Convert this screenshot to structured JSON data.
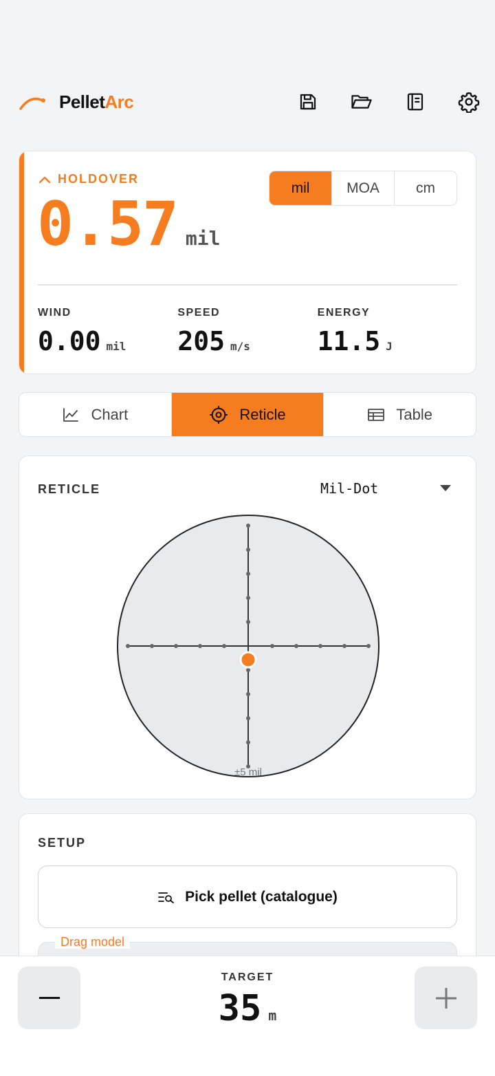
{
  "app": {
    "brand_part1": "Pellet",
    "brand_part2": "Arc",
    "accent": "#f57c1f"
  },
  "header": {
    "actions": [
      {
        "name": "save-icon"
      },
      {
        "name": "folder-open-icon"
      },
      {
        "name": "notebook-icon"
      },
      {
        "name": "gear-icon"
      }
    ]
  },
  "holdover": {
    "label": "HOLDOVER",
    "value": "0.57",
    "unit": "mil",
    "unit_options": [
      "mil",
      "MOA",
      "cm"
    ],
    "selected_unit": "mil"
  },
  "stats": {
    "wind": {
      "label": "WIND",
      "value": "0.00",
      "unit": "mil"
    },
    "speed": {
      "label": "SPEED",
      "value": "205",
      "unit": "m/s"
    },
    "energy": {
      "label": "ENERGY",
      "value": "11.5",
      "unit": "J"
    }
  },
  "view_tabs": [
    {
      "label": "Chart",
      "icon": "line-chart-icon"
    },
    {
      "label": "Reticle",
      "icon": "crosshair-icon",
      "active": true
    },
    {
      "label": "Table",
      "icon": "table-icon"
    }
  ],
  "reticle": {
    "title": "RETICLE",
    "selected_type": "Mil-Dot",
    "range_label": "±5 mil",
    "range_mil": 5,
    "impact_mil": {
      "x": 0,
      "y": 0.57
    }
  },
  "setup": {
    "title": "SETUP",
    "pick_pellet_label": "Pick pellet (catalogue)",
    "drag_model_label": "Drag model"
  },
  "target": {
    "label": "TARGET",
    "value": "35",
    "unit": "m"
  }
}
